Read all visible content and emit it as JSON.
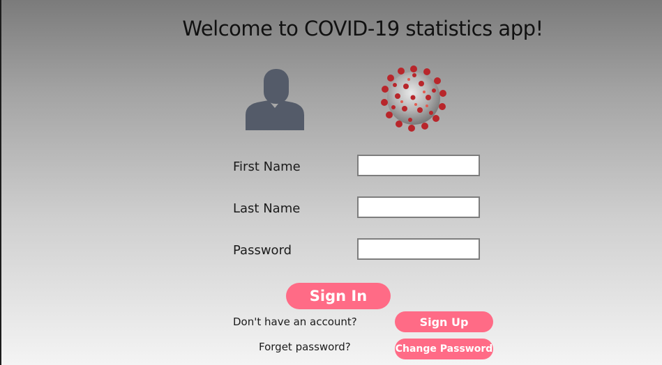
{
  "app": {
    "title": "Welcome to COVID-19 statistics app!"
  },
  "icons": {
    "avatar": "user-avatar-icon",
    "virus": "coronavirus-icon"
  },
  "form": {
    "first_name_label": "First Name",
    "first_name_value": "",
    "last_name_label": "Last Name",
    "last_name_value": "",
    "password_label": "Password",
    "password_value": ""
  },
  "actions": {
    "sign_in": "Sign In",
    "no_account_text": "Don't have an account?",
    "sign_up": "Sign Up",
    "forgot_text": "Forget password?",
    "change_password": "Change Password"
  },
  "colors": {
    "accent": "#ff6b86",
    "avatar": "#545b69"
  }
}
